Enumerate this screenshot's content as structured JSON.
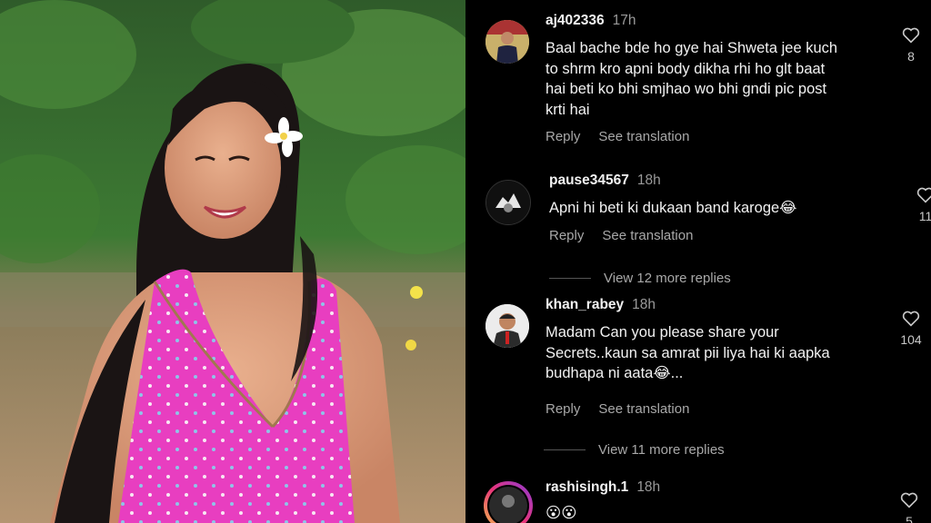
{
  "comments": [
    {
      "username": "aj402336",
      "time": "17h",
      "lines": [
        "Baal bache bde ho gye hai Shweta jee kuch",
        "to shrm kro apni body dikha rhi ho glt baat",
        "hai beti ko bhi smjhao wo bhi gndi pic post",
        "krti hai"
      ],
      "reply": "Reply",
      "translate": "See translation",
      "likes": "8"
    },
    {
      "username": "pause34567",
      "time": "18h",
      "lines": [
        "Apni hi beti ki dukaan band karoge😂"
      ],
      "reply": "Reply",
      "translate": "See translation",
      "likes": "11",
      "view_replies": "View 12 more replies"
    },
    {
      "username": "khan_rabey",
      "time": "18h",
      "lines": [
        "Madam Can you please share your",
        "Secrets..kaun sa amrat pii liya hai ki aapka",
        "budhapa ni aata😂..."
      ],
      "reply": "Reply",
      "translate": "See translation",
      "likes": "104",
      "view_replies": "View 11 more replies"
    },
    {
      "username": "rashisingh.1",
      "time": "18h",
      "lines": [
        "😮😮"
      ],
      "likes": "5"
    }
  ],
  "icons": {
    "like": "heart-outline-icon"
  },
  "colors": {
    "background": "#000000",
    "text": "#f2f2f2",
    "muted": "#a8a8a8",
    "swimsuit": "#e83ec0"
  }
}
